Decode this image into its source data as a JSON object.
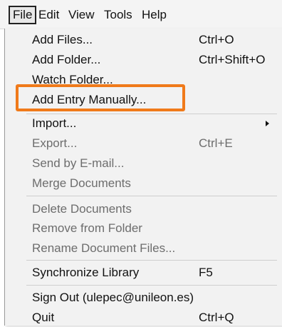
{
  "menubar": {
    "items": [
      {
        "label": "File"
      },
      {
        "label": "Edit"
      },
      {
        "label": "View"
      },
      {
        "label": "Tools"
      },
      {
        "label": "Help"
      }
    ]
  },
  "file_menu": {
    "items": [
      {
        "label": "Add Files...",
        "shortcut": "Ctrl+O"
      },
      {
        "label": "Add Folder...",
        "shortcut": "Ctrl+Shift+O"
      },
      {
        "label": "Watch Folder..."
      },
      {
        "label": "Add Entry Manually..."
      },
      {
        "label": "Import...",
        "has_submenu": true
      },
      {
        "label": "Export...",
        "shortcut": "Ctrl+E",
        "disabled": true
      },
      {
        "label": "Send by E-mail...",
        "disabled": true
      },
      {
        "label": "Merge Documents",
        "disabled": true
      },
      {
        "label": "Delete Documents",
        "disabled": true
      },
      {
        "label": "Remove from Folder",
        "disabled": true
      },
      {
        "label": "Rename Document Files...",
        "disabled": true
      },
      {
        "label": "Synchronize Library",
        "shortcut": "F5"
      },
      {
        "label": "Sign Out (ulepec@unileon.es)"
      },
      {
        "label": "Quit",
        "shortcut": "Ctrl+Q"
      }
    ]
  },
  "colors": {
    "highlight": "#f07a1a",
    "menu_bg": "#f2f2f2",
    "disabled_text": "#6d6d6d"
  }
}
